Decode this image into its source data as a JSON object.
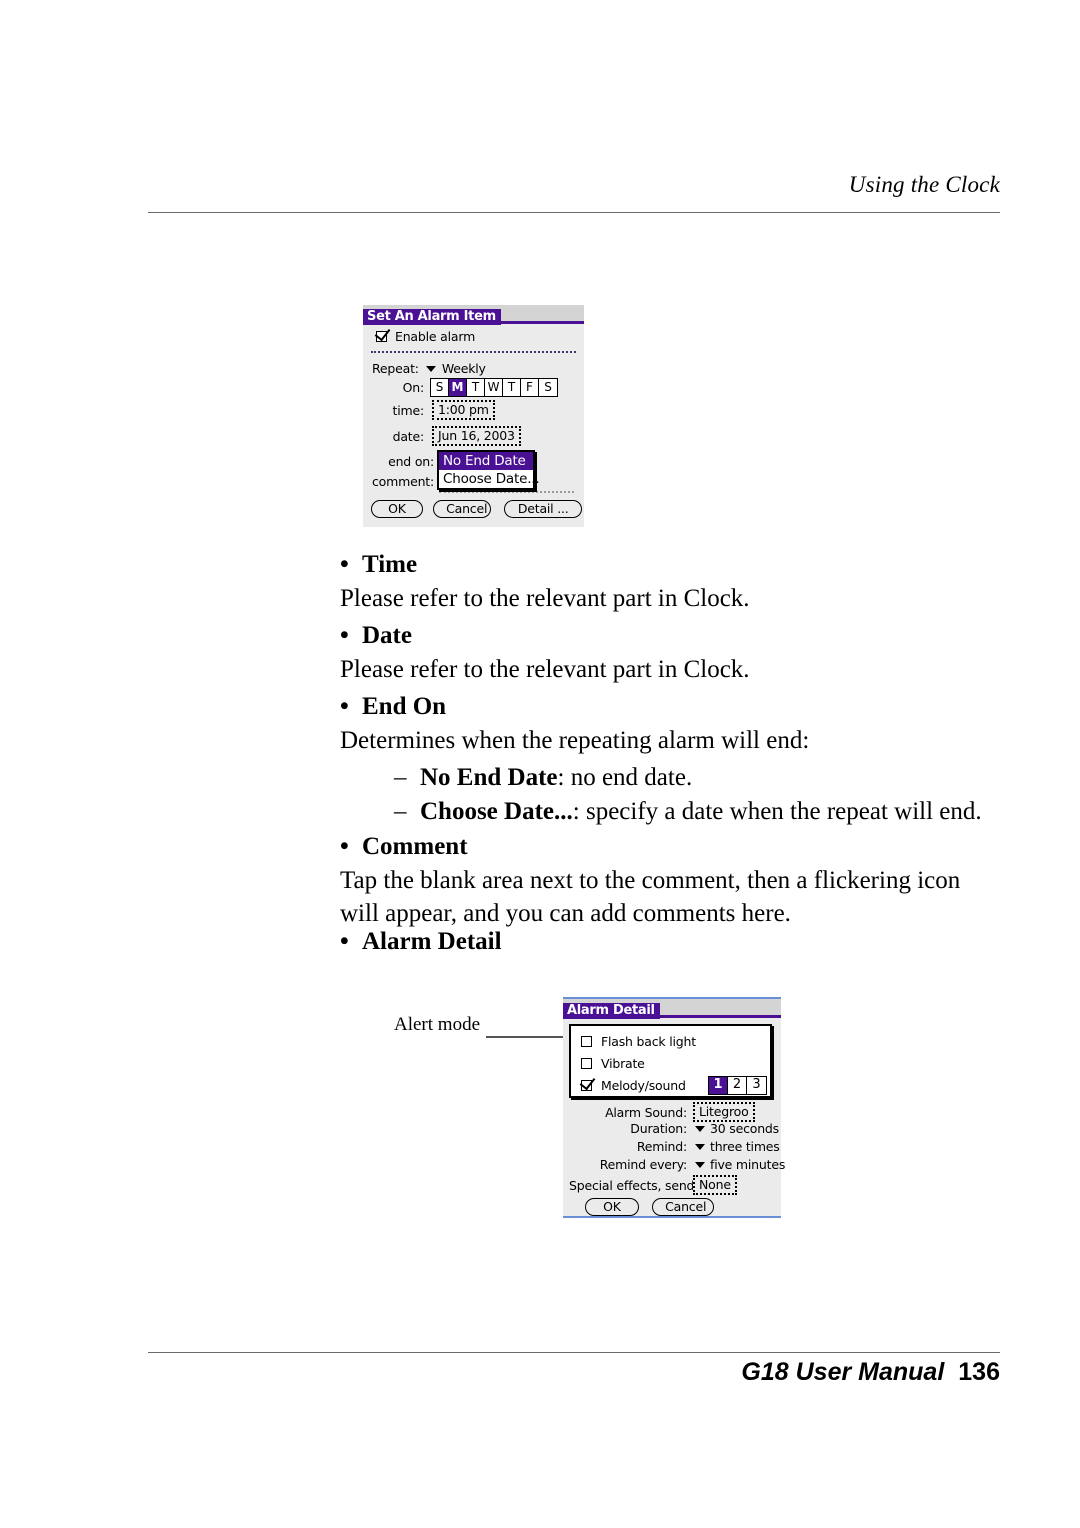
{
  "header": {
    "title": "Using the Clock"
  },
  "footer": {
    "manual": "G18 User Manual",
    "page": "136"
  },
  "body": {
    "sections": [
      {
        "heading": "Time",
        "paragraph": "Please refer to the relevant part in Clock."
      },
      {
        "heading": "Date",
        "paragraph": "Please refer to the relevant part in Clock."
      },
      {
        "heading": "End On",
        "paragraph": "Determines when the repeating alarm will end:"
      },
      {
        "heading": "Comment",
        "paragraph": "Tap the blank area next to the comment, then a flickering icon will appear, and you can add comments here."
      },
      {
        "heading": "Alarm Detail",
        "paragraph": ""
      }
    ],
    "end_on_items": [
      {
        "term": "No End Date",
        "desc": ": no end date."
      },
      {
        "term": "Choose Date...",
        "desc": ": specify a date when the repeat will end."
      }
    ],
    "bullet_glyph": "•",
    "dash_glyph": "–"
  },
  "callout": {
    "alert_mode_label": "Alert mode"
  },
  "dialog_alarm_item": {
    "title": "Set An Alarm Item",
    "enable_alarm_label": "Enable alarm",
    "enable_alarm_checked": true,
    "repeat_label": "Repeat:",
    "repeat_value": "Weekly",
    "on_label": "On:",
    "days": [
      {
        "letter": "S",
        "selected": false
      },
      {
        "letter": "M",
        "selected": true
      },
      {
        "letter": "T",
        "selected": false
      },
      {
        "letter": "W",
        "selected": false
      },
      {
        "letter": "T",
        "selected": false
      },
      {
        "letter": "F",
        "selected": false
      },
      {
        "letter": "S",
        "selected": false
      }
    ],
    "time_label": "time:",
    "time_value": "1:00 pm",
    "date_label": "date:",
    "date_value": "Jun 16, 2003",
    "end_on_label": "end on:",
    "comment_label": "comment:",
    "end_on_options": [
      {
        "label": "No End Date",
        "selected": true
      },
      {
        "label": "Choose Date...",
        "selected": false
      }
    ],
    "buttons": [
      "OK",
      "Cancel",
      "Detail ..."
    ]
  },
  "dialog_alarm_detail": {
    "title": "Alarm Detail",
    "alert_modes": [
      {
        "label": "Flash back light",
        "checked": false
      },
      {
        "label": "Vibrate",
        "checked": false
      },
      {
        "label": "Melody/sound",
        "checked": true
      }
    ],
    "melody_numbers": [
      {
        "label": "1",
        "selected": true
      },
      {
        "label": "2",
        "selected": false
      },
      {
        "label": "3",
        "selected": false
      }
    ],
    "fields": [
      {
        "label": "Alarm Sound:",
        "value": "Litegroo",
        "kind": "field"
      },
      {
        "label": "Duration:",
        "value": "30 seconds",
        "kind": "pulldown"
      },
      {
        "label": "Remind:",
        "value": "three times",
        "kind": "pulldown"
      },
      {
        "label": "Remind every:",
        "value": "five minutes",
        "kind": "pulldown"
      },
      {
        "label": "Special effects, send:",
        "value": "None",
        "kind": "field"
      }
    ],
    "buttons": [
      "OK",
      "Cancel"
    ]
  },
  "colors": {
    "palm_purple": "#4a1194",
    "dialog_bg": "#ebebeb",
    "titlebar_bg": "#d4d4d4",
    "rule": "#6b6b6b"
  }
}
